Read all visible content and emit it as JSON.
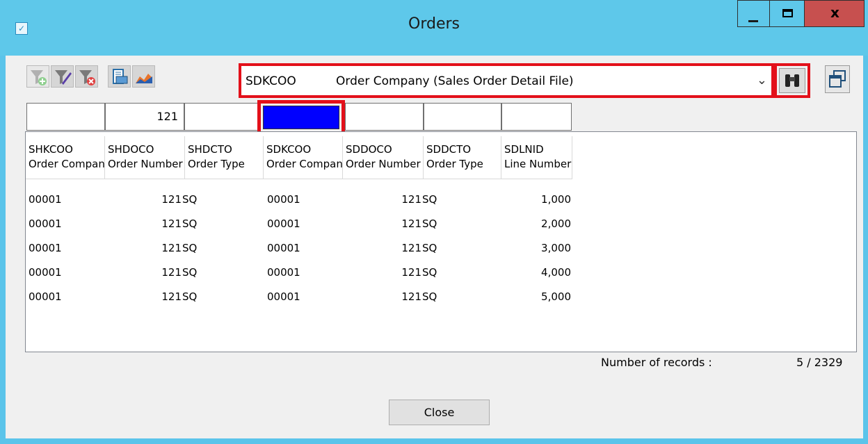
{
  "window": {
    "title": "Orders",
    "app_icon": "app-v-icon",
    "controls": {
      "minimize": "minimize-icon",
      "maximize": "maximize-icon",
      "close_label": "x"
    }
  },
  "toolbar": {
    "buttons": [
      "add-filter-icon",
      "edit-filter-icon",
      "remove-filter-icon",
      "print-icon",
      "chart-icon"
    ]
  },
  "field_selector": {
    "code": "SDKCOO",
    "description": "Order Company (Sales Order Detail File)",
    "dropdown_icon": "chevron-down-icon",
    "find_icon": "binoculars-icon",
    "restore_icon": "restore-window-icon"
  },
  "filters": [
    "",
    "121",
    "",
    "",
    "",
    "",
    ""
  ],
  "table": {
    "columns": [
      {
        "code": "SHKCOO",
        "label": "Order Company"
      },
      {
        "code": "SHDOCO",
        "label": "Order Number"
      },
      {
        "code": "SHDCTO",
        "label": "Order Type"
      },
      {
        "code": "SDKCOO",
        "label": "Order Company"
      },
      {
        "code": "SDDOCO",
        "label": "Order Number"
      },
      {
        "code": "SDDCTO",
        "label": "Order Type"
      },
      {
        "code": "SDLNID",
        "label": "Line Number"
      }
    ],
    "rows": [
      [
        "00001",
        "121",
        "SQ",
        "00001",
        "121",
        "SQ",
        "1,000"
      ],
      [
        "00001",
        "121",
        "SQ",
        "00001",
        "121",
        "SQ",
        "2,000"
      ],
      [
        "00001",
        "121",
        "SQ",
        "00001",
        "121",
        "SQ",
        "3,000"
      ],
      [
        "00001",
        "121",
        "SQ",
        "00001",
        "121",
        "SQ",
        "4,000"
      ],
      [
        "00001",
        "121",
        "SQ",
        "00001",
        "121",
        "SQ",
        "5,000"
      ]
    ]
  },
  "footer": {
    "records_label": "Number of records :",
    "records_value": "5 / 2329",
    "close_label": "Close"
  },
  "colors": {
    "titlebar": "#5ec8ea",
    "close_button": "#c7504f",
    "highlight": "#e3101a",
    "selected_filter": "#0000ff"
  }
}
